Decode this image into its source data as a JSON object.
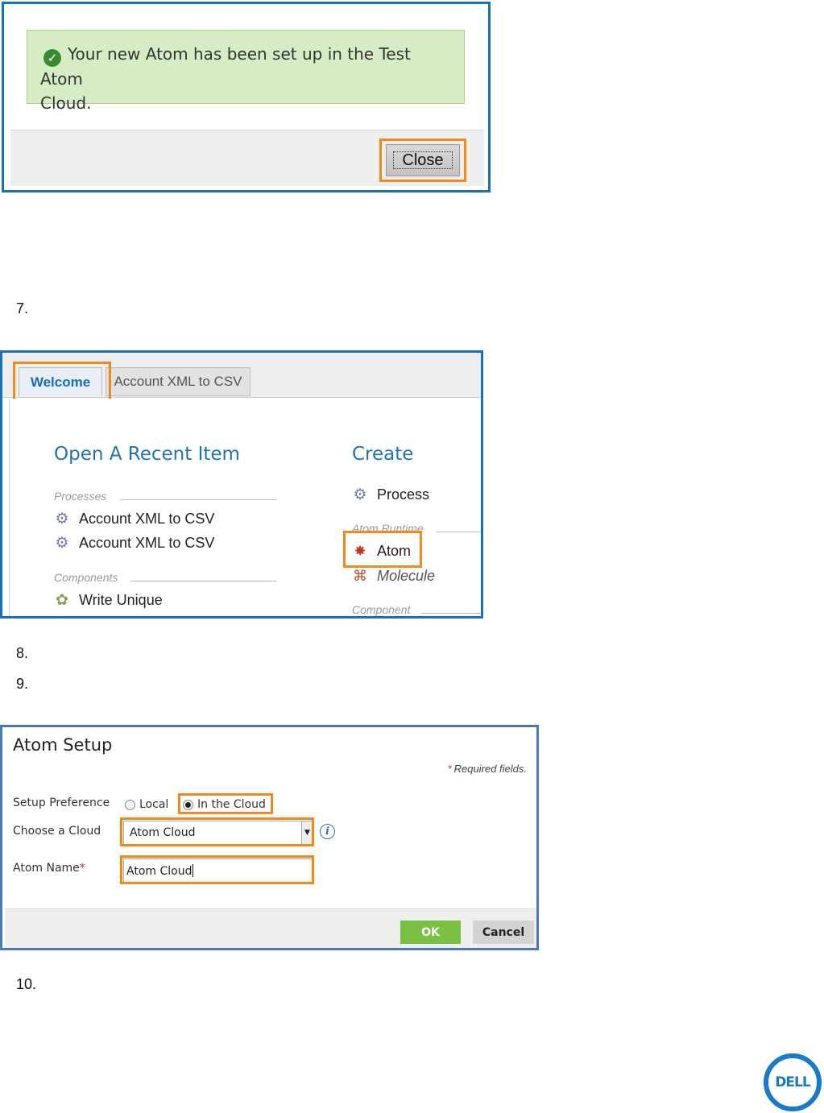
{
  "shot1": {
    "message": "Your new Atom has been set up in the Test Atom Cloud.",
    "message_line1": "Your new Atom has been set up in the Test Atom",
    "message_line2": "Cloud.",
    "close_label": "Close"
  },
  "steps": {
    "s7": "7.",
    "s8": "8.",
    "s9": "9.",
    "s10": "10."
  },
  "shot2": {
    "tabs": [
      "Welcome",
      "Account XML to CSV"
    ],
    "recent_heading": "Open A Recent Item",
    "create_heading": "Create",
    "processes_label": "Processes",
    "recent_items": [
      "Account XML to CSV",
      "Account XML to CSV"
    ],
    "components_label": "Components",
    "component_items": [
      "Write Unique"
    ],
    "create_process": "Process",
    "atom_runtime_label": "Atom Runtime",
    "create_atom": "Atom",
    "create_molecule": "Molecule",
    "component_label": "Component"
  },
  "shot3": {
    "title": "Atom Setup",
    "required_note": "Required fields.",
    "setup_pref_label": "Setup Preference",
    "option_local": "Local",
    "option_cloud": "In the Cloud",
    "choose_cloud_label": "Choose a Cloud",
    "cloud_value": "Atom Cloud",
    "atom_name_label": "Atom Name",
    "atom_name_value": "Atom Cloud",
    "ok_label": "OK",
    "cancel_label": "Cancel"
  },
  "logo": {
    "text": "DELL"
  },
  "colors": {
    "highlight": "#f08a1c",
    "frame": "#1a6fb5",
    "success_bg": "#d6ecc4",
    "ok_green": "#7ac143",
    "heading_blue": "#1d74b8"
  }
}
